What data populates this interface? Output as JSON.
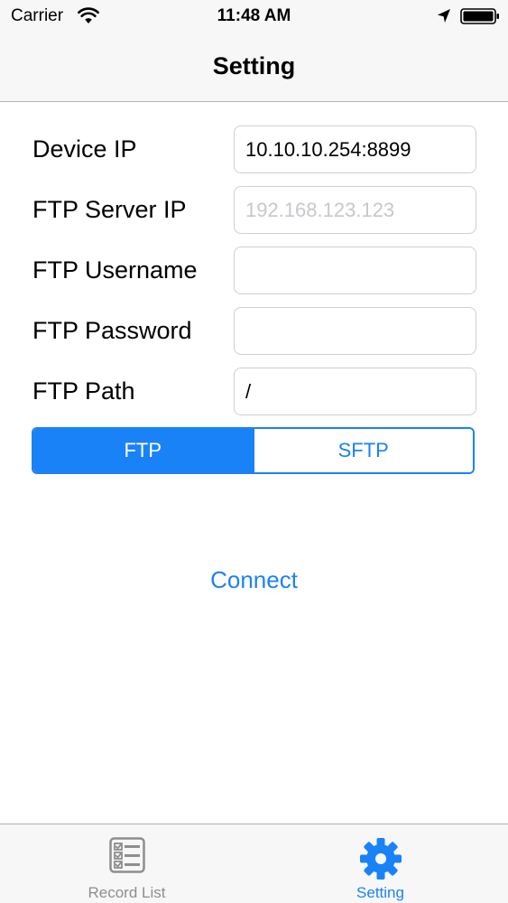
{
  "status_bar": {
    "carrier": "Carrier",
    "time": "11:48 AM",
    "icons": [
      "wifi-icon",
      "location-arrow-icon",
      "battery-icon"
    ]
  },
  "nav_bar": {
    "title": "Setting"
  },
  "form": {
    "device_ip": {
      "label": "Device IP",
      "value": "10.10.10.254:8899",
      "placeholder": ""
    },
    "ftp_server_ip": {
      "label": "FTP Server IP",
      "value": "",
      "placeholder": "192.168.123.123"
    },
    "ftp_username": {
      "label": "FTP Username",
      "value": "",
      "placeholder": ""
    },
    "ftp_password": {
      "label": "FTP Password",
      "value": "",
      "placeholder": ""
    },
    "ftp_path": {
      "label": "FTP Path",
      "value": "/",
      "placeholder": ""
    }
  },
  "protocol_selector": {
    "options": [
      "FTP",
      "SFTP"
    ],
    "selected": "FTP"
  },
  "connect": {
    "label": "Connect"
  },
  "tab_bar": {
    "items": [
      {
        "label": "Record List",
        "icon": "checklist-icon",
        "active": false
      },
      {
        "label": "Setting",
        "icon": "gear-icon",
        "active": true
      }
    ]
  },
  "colors": {
    "accent": "#1a82f7",
    "bar_background": "#f7f7f7",
    "inactive_tab": "#8e8e8e",
    "placeholder": "#c7c7cd"
  }
}
